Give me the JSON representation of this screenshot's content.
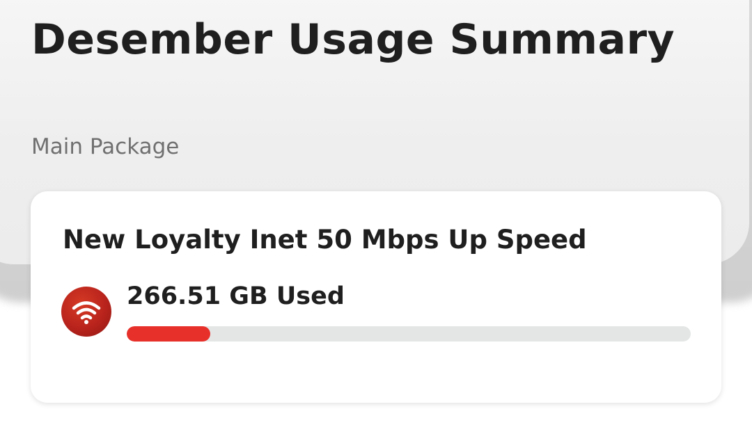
{
  "header": {
    "title": "Desember Usage Summary"
  },
  "section": {
    "label": "Main Package"
  },
  "package": {
    "name": "New Loyalty Inet 50 Mbps Up Speed",
    "icon": "wifi-icon",
    "usage_text": "266.51 GB Used",
    "progress_fraction": 0.148
  },
  "colors": {
    "accent": "#e8302a",
    "icon_bg": "#b8231c",
    "track": "#e4e6e6"
  }
}
